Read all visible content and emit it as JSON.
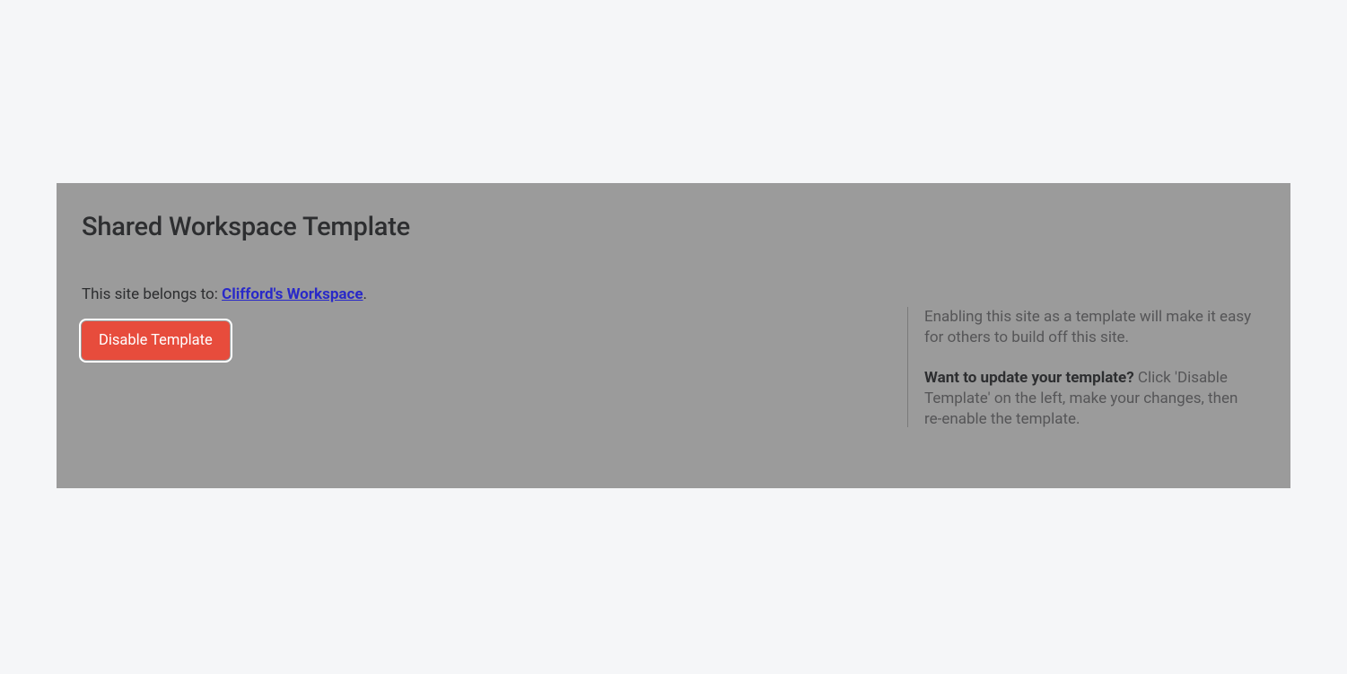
{
  "main": {
    "title": "Shared Workspace Template",
    "belongs_prefix": "This site belongs to: ",
    "workspace_name": "Clifford's Workspace",
    "belongs_suffix": ".",
    "disable_button_label": "Disable Template"
  },
  "sidebar": {
    "info_paragraph_1": "Enabling this site as a template will make it easy for others to build off this site.",
    "update_heading": "Want to update your template?",
    "update_instructions": " Click 'Disable Template' on the left, make your changes, then re-enable the template."
  },
  "colors": {
    "page_bg": "#f5f6f8",
    "card_bg": "#9b9b9b",
    "button_bg": "#e74c3c",
    "link_color": "#2929c8"
  }
}
